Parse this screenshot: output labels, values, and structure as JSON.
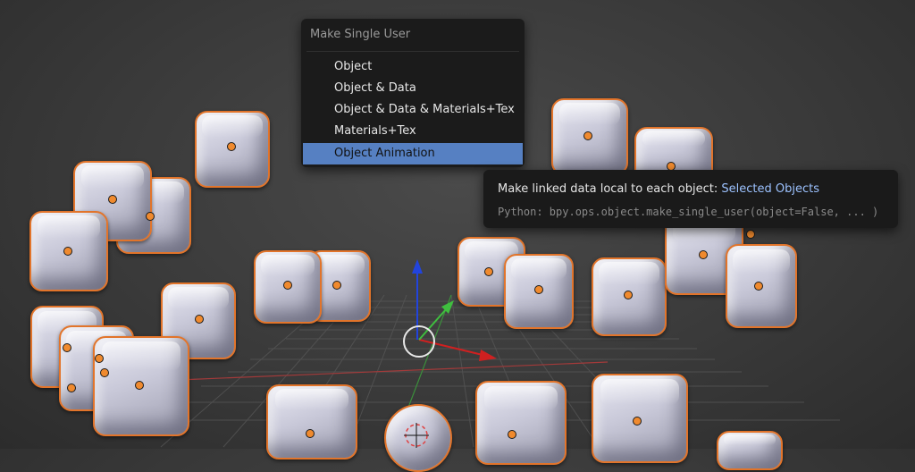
{
  "menu": {
    "title": "Make Single User",
    "items": [
      {
        "label": "Object"
      },
      {
        "label": "Object & Data"
      },
      {
        "label": "Object & Data & Materials+Tex"
      },
      {
        "label": "Materials+Tex"
      },
      {
        "label": "Object Animation",
        "active": true
      }
    ]
  },
  "tooltip": {
    "description": "Make linked data local to each object:",
    "value": "Selected Objects",
    "python": "Python: bpy.ops.object.make_single_user(object=False, ... )"
  },
  "colors": {
    "selection_outline": "#e2742a",
    "menu_highlight": "#5680c2",
    "axis_x": "#d02020",
    "axis_y": "#3fbf3f",
    "axis_z": "#2244dd"
  }
}
